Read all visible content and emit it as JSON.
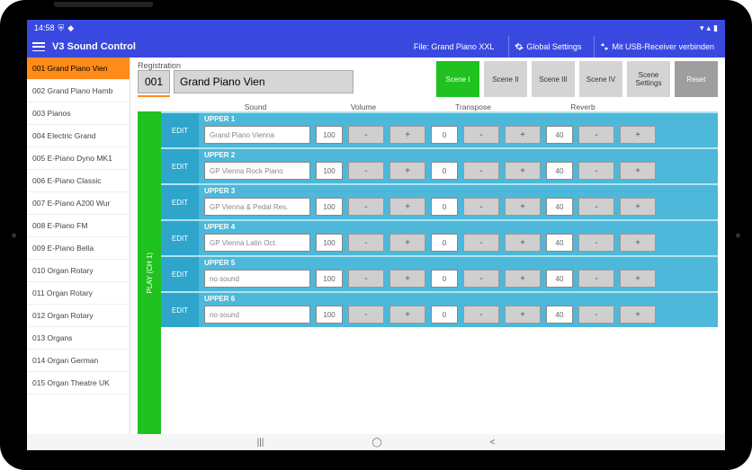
{
  "status": {
    "time": "14:58"
  },
  "header": {
    "title": "V3 Sound Control",
    "file": "File: Grand Piano XXL",
    "global": "Global Settings",
    "connect": "Mit USB-Receiver verbinden"
  },
  "sidebar": {
    "items": [
      {
        "label": "001 Grand Piano Vien",
        "active": true
      },
      {
        "label": "002 Grand Piano Hamb"
      },
      {
        "label": "003 Pianos"
      },
      {
        "label": "004 Electric Grand"
      },
      {
        "label": "005 E-Piano Dyno MK1"
      },
      {
        "label": "006 E-Piano Classic"
      },
      {
        "label": "007 E-Piano A200 Wur"
      },
      {
        "label": "008 E-Piano FM"
      },
      {
        "label": "009 E-Piano Bella"
      },
      {
        "label": "010 Organ Rotary"
      },
      {
        "label": "011 Organ Rotary"
      },
      {
        "label": "012 Organ Rotary"
      },
      {
        "label": "013 Organs"
      },
      {
        "label": "014 Organ German"
      },
      {
        "label": "015 Organ Theatre UK"
      }
    ]
  },
  "registration": {
    "label": "Registration",
    "number": "001",
    "name": "Grand Piano Vien"
  },
  "scenes": [
    {
      "label": "Scene I",
      "active": true
    },
    {
      "label": "Scene II"
    },
    {
      "label": "Scene III"
    },
    {
      "label": "Scene IV"
    },
    {
      "label": "Scene\nSettings"
    },
    {
      "label": "Reset",
      "dark": true
    }
  ],
  "columns": {
    "sound": "Sound",
    "volume": "Volume",
    "transpose": "Transpose",
    "reverb": "Reverb"
  },
  "play": {
    "label": "PLAY (CH 1)",
    "edit": "EDIT"
  },
  "rows": [
    {
      "name": "UPPER 1",
      "sound": "Grand Piano Vienna",
      "volume": "100",
      "transpose": "0",
      "reverb": "40"
    },
    {
      "name": "UPPER 2",
      "sound": "GP Vienna Rock Piano",
      "volume": "100",
      "transpose": "0",
      "reverb": "40"
    },
    {
      "name": "UPPER 3",
      "sound": "GP Vienna & Pedal Res.",
      "volume": "100",
      "transpose": "0",
      "reverb": "40"
    },
    {
      "name": "UPPER 4",
      "sound": "GP Vienna Latin Oct.",
      "volume": "100",
      "transpose": "0",
      "reverb": "40"
    },
    {
      "name": "UPPER 5",
      "sound": "no sound",
      "volume": "100",
      "transpose": "0",
      "reverb": "40"
    },
    {
      "name": "UPPER 6",
      "sound": "no sound",
      "volume": "100",
      "transpose": "0",
      "reverb": "40"
    }
  ],
  "btn": {
    "minus": "-",
    "plus": "+"
  }
}
